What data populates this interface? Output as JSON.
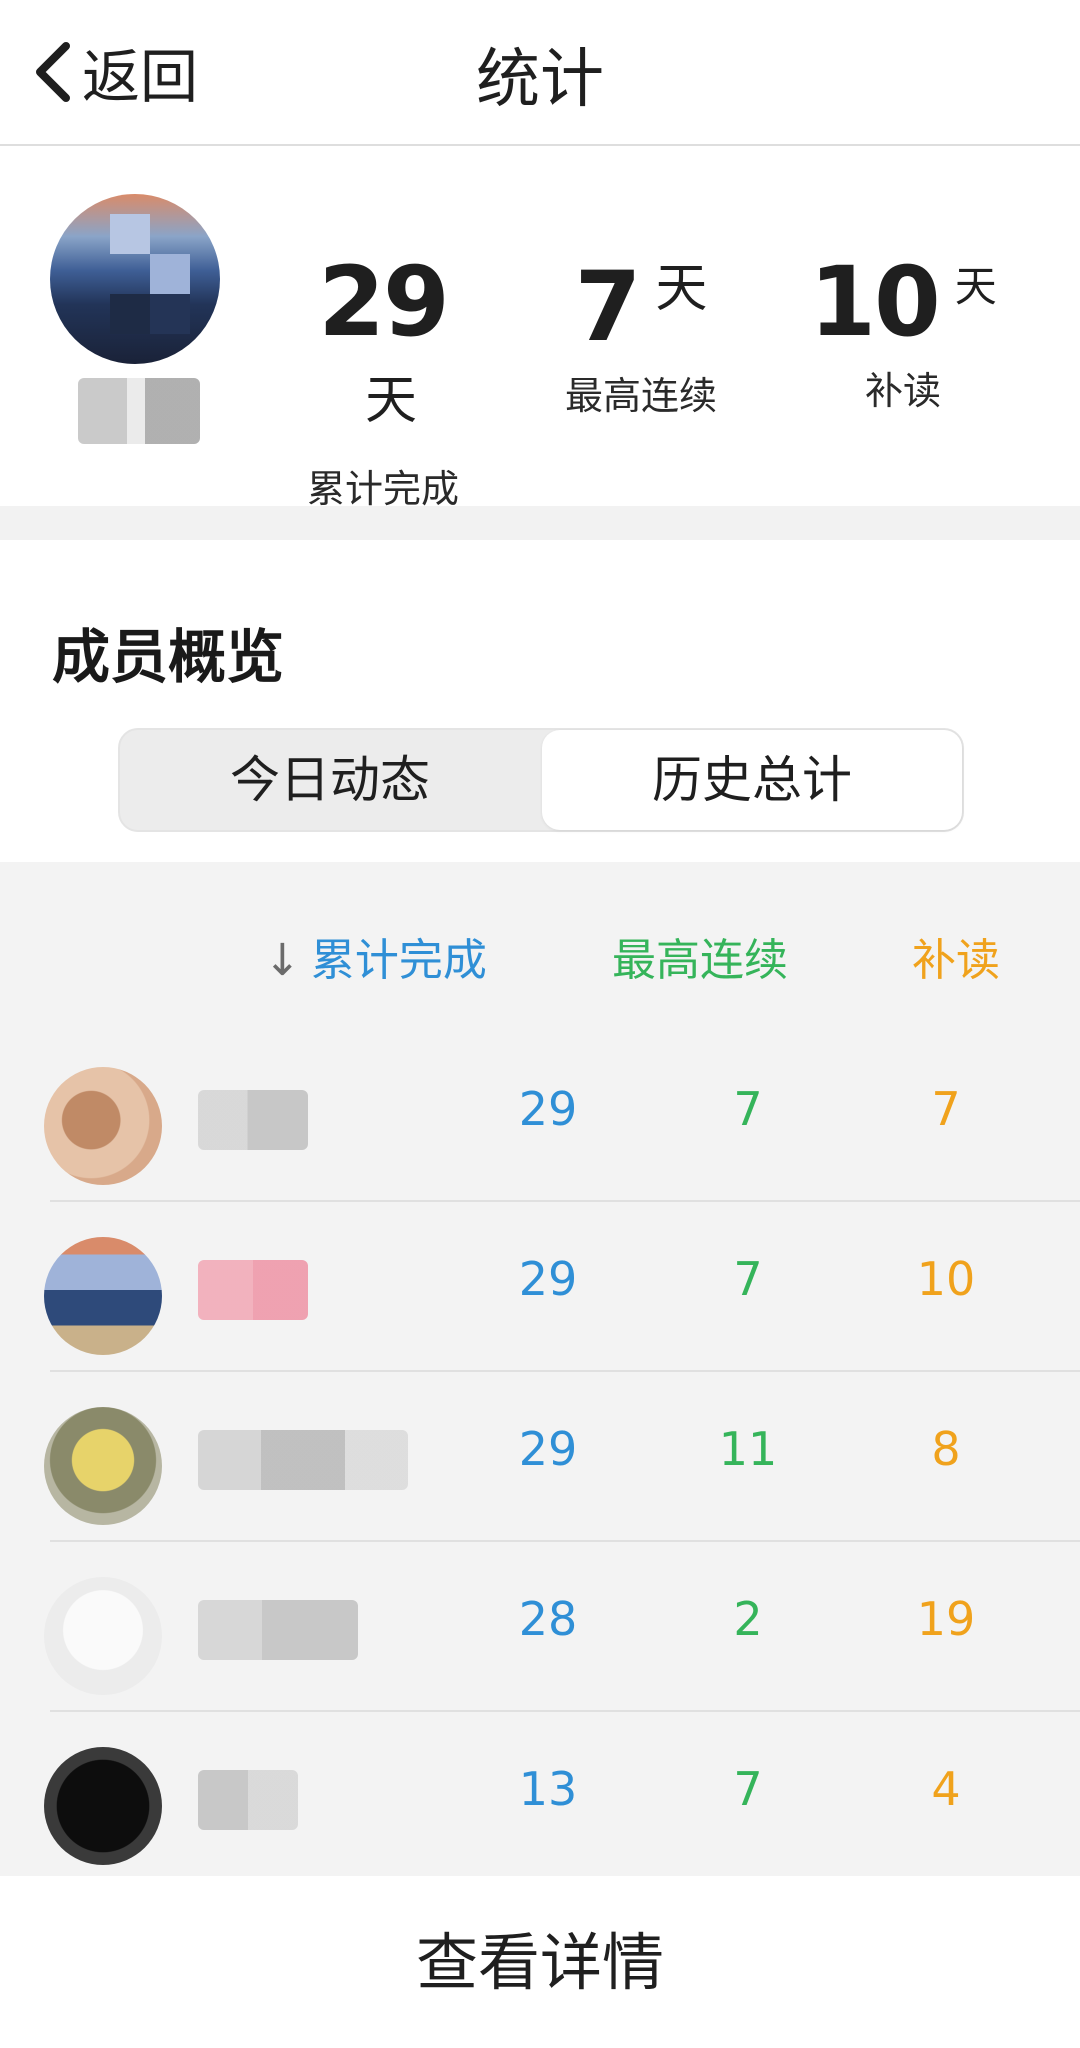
{
  "header": {
    "back_label": "返回",
    "title": "统计"
  },
  "summary": {
    "stats": [
      {
        "value": "29",
        "unit": "天",
        "label": "累计完成"
      },
      {
        "value": "7",
        "unit": "天",
        "label": "最高连续"
      },
      {
        "value": "10",
        "unit": "天",
        "label": "补读"
      }
    ]
  },
  "overview": {
    "title": "成员概览",
    "tabs": [
      {
        "label": "今日动态"
      },
      {
        "label": "历史总计"
      }
    ],
    "selected_tab": "历史总计",
    "columns": [
      "累计完成",
      "最高连续",
      "补读"
    ],
    "rows": [
      {
        "completed": "29",
        "streak": "7",
        "makeup": "7"
      },
      {
        "completed": "29",
        "streak": "7",
        "makeup": "10"
      },
      {
        "completed": "29",
        "streak": "11",
        "makeup": "8"
      },
      {
        "completed": "28",
        "streak": "2",
        "makeup": "19"
      },
      {
        "completed": "13",
        "streak": "7",
        "makeup": "4"
      }
    ]
  },
  "footer": {
    "details_label": "查看详情"
  },
  "colors": {
    "blue": "#2f8fd6",
    "green": "#35b45a",
    "orange": "#f0a21c"
  }
}
